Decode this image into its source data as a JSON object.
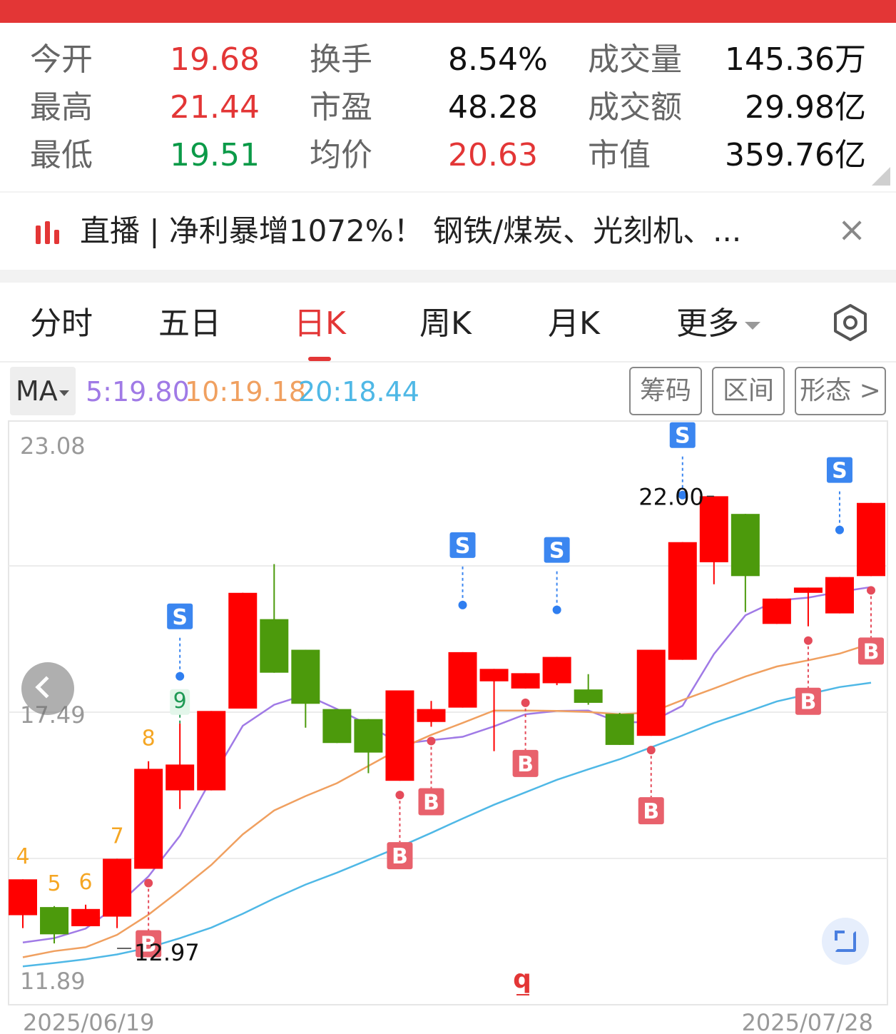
{
  "stats": [
    {
      "label": "今开",
      "value": "19.68",
      "color": "#e33636"
    },
    {
      "label": "换手",
      "value": "8.54%",
      "color": "#111111"
    },
    {
      "label": "成交量",
      "value": "145.36万",
      "color": "#111111"
    },
    {
      "label": "最高",
      "value": "21.44",
      "color": "#e33636"
    },
    {
      "label": "市盈",
      "value": "48.28",
      "color": "#111111"
    },
    {
      "label": "成交额",
      "value": "29.98亿",
      "color": "#111111"
    },
    {
      "label": "最低",
      "value": "19.51",
      "color": "#0b9a48"
    },
    {
      "label": "均价",
      "value": "20.63",
      "color": "#e33636"
    },
    {
      "label": "市值",
      "value": "359.76亿",
      "color": "#111111"
    }
  ],
  "news": {
    "text": "直播 | 净利暴增1072%！ 钢铁/煤炭、光刻机、...",
    "close": "×"
  },
  "tabs": [
    {
      "label": "分时"
    },
    {
      "label": "五日"
    },
    {
      "label": "日K"
    },
    {
      "label": "周K"
    },
    {
      "label": "月K"
    },
    {
      "label": "更多"
    }
  ],
  "active_tab": "日K",
  "indicator": {
    "selector": "MA",
    "ma5": "5:19.80",
    "ma10": "10:19.18",
    "ma20": "20:18.44",
    "ma5_color": "#a07ae6",
    "ma10_color": "#f0a060",
    "ma20_color": "#4fb8e6"
  },
  "pills": [
    "筹码",
    "区间",
    "形态 >"
  ],
  "chart_data": {
    "type": "candlestick",
    "y_axis_labels": [
      "23.08",
      "17.49",
      "11.89"
    ],
    "ylim": [
      11.89,
      23.08
    ],
    "x_axis_labels": [
      "2025/06/19",
      "2025/07/28"
    ],
    "max_label": "22.00",
    "min_label": "12.97",
    "up_color": "#ff0000",
    "down_color": "#4c9a0c",
    "candles": [
      {
        "o": 13.24,
        "h": 13.65,
        "l": 12.97,
        "c": 13.99
      },
      {
        "o": 13.41,
        "h": 13.43,
        "l": 12.65,
        "c": 12.84
      },
      {
        "o": 13.01,
        "h": 13.46,
        "l": 13.07,
        "c": 13.37
      },
      {
        "o": 13.21,
        "h": 14.21,
        "l": 12.97,
        "c": 14.42
      },
      {
        "o": 14.21,
        "h": 16.46,
        "l": 15.85,
        "c": 16.3
      },
      {
        "o": 15.85,
        "h": 17.25,
        "l": 15.46,
        "c": 16.39
      },
      {
        "o": 15.85,
        "h": 17.51,
        "l": 17.51,
        "c": 17.51
      },
      {
        "o": 17.56,
        "h": 19.04,
        "l": 19.73,
        "c": 19.98
      },
      {
        "o": 19.43,
        "h": 20.58,
        "l": 18.31,
        "c": 18.31
      },
      {
        "o": 18.79,
        "h": 17.82,
        "l": 17.16,
        "c": 17.66
      },
      {
        "o": 17.55,
        "h": 17.53,
        "l": 16.84,
        "c": 16.84
      },
      {
        "o": 17.34,
        "h": 16.86,
        "l": 16.21,
        "c": 16.64
      },
      {
        "o": 16.05,
        "h": 17.64,
        "l": 17.77,
        "c": 17.94
      },
      {
        "o": 17.28,
        "h": 17.72,
        "l": 17.18,
        "c": 17.55
      },
      {
        "o": 17.58,
        "h": 17.95,
        "l": 17.63,
        "c": 18.74
      },
      {
        "o": 18.13,
        "h": 18.21,
        "l": 16.67,
        "c": 18.39
      },
      {
        "o": 17.98,
        "h": 18.24,
        "l": 18.05,
        "c": 18.3
      },
      {
        "o": 18.09,
        "h": 18.46,
        "l": 18.05,
        "c": 18.64
      },
      {
        "o": 17.96,
        "h": 18.28,
        "l": 17.64,
        "c": 17.68
      },
      {
        "o": 17.45,
        "h": 17.47,
        "l": 16.99,
        "c": 16.8
      },
      {
        "o": 16.99,
        "h": 18.36,
        "l": 18.36,
        "c": 18.79
      },
      {
        "o": 18.58,
        "h": 20.43,
        "l": 20.75,
        "c": 21.04
      },
      {
        "o": 20.62,
        "h": 20.62,
        "l": 20.16,
        "c": 22.0
      },
      {
        "o": 21.63,
        "h": 19.98,
        "l": 19.58,
        "c": 20.33
      },
      {
        "o": 19.33,
        "h": 19.85,
        "l": 19.82,
        "c": 19.86
      },
      {
        "o": 19.98,
        "h": 19.48,
        "l": 19.28,
        "c": 20.09
      },
      {
        "o": 19.55,
        "h": 19.76,
        "l": 19.96,
        "c": 20.31
      },
      {
        "o": 20.33,
        "h": 21.44,
        "l": 21.44,
        "c": 21.86
      }
    ],
    "series": [
      {
        "name": "MA5",
        "values": [
          12.67,
          12.76,
          12.96,
          13.44,
          14.05,
          14.9,
          16.08,
          17.2,
          17.64,
          17.85,
          17.55,
          17.22,
          16.82,
          16.9,
          16.97,
          17.19,
          17.44,
          17.51,
          17.52,
          17.27,
          17.28,
          17.62,
          18.7,
          19.51,
          19.82,
          19.88,
          20.0,
          20.1
        ]
      },
      {
        "name": "MA10",
        "values": [
          12.36,
          12.49,
          12.57,
          12.83,
          13.25,
          13.76,
          14.29,
          14.93,
          15.43,
          15.73,
          16.0,
          16.36,
          16.72,
          17.01,
          17.26,
          17.52,
          17.52,
          17.51,
          17.49,
          17.44,
          17.48,
          17.74,
          17.98,
          18.23,
          18.44,
          18.57,
          18.71,
          18.92
        ]
      },
      {
        "name": "MA20",
        "values": [
          12.17,
          12.24,
          12.32,
          12.42,
          12.56,
          12.76,
          12.98,
          13.27,
          13.59,
          13.88,
          14.13,
          14.4,
          14.67,
          14.96,
          15.26,
          15.55,
          15.81,
          16.07,
          16.29,
          16.5,
          16.75,
          17.0,
          17.26,
          17.48,
          17.71,
          17.86,
          18.01,
          18.1
        ]
      }
    ],
    "signals": [
      {
        "index": 0,
        "type": "num",
        "label": "4",
        "pos": "above"
      },
      {
        "index": 1,
        "type": "num",
        "label": "5",
        "pos": "above"
      },
      {
        "index": 2,
        "type": "num",
        "label": "6",
        "pos": "above"
      },
      {
        "index": 3,
        "type": "num",
        "label": "7",
        "pos": "above"
      },
      {
        "index": 4,
        "type": "num",
        "label": "8",
        "pos": "above"
      },
      {
        "index": 4,
        "type": "B",
        "label": "B",
        "pos": "below"
      },
      {
        "index": 5,
        "type": "num9",
        "label": "9",
        "pos": "above"
      },
      {
        "index": 5,
        "type": "S",
        "label": "S",
        "pos": "above"
      },
      {
        "index": 12,
        "type": "B",
        "label": "B",
        "pos": "below"
      },
      {
        "index": 13,
        "type": "B",
        "label": "B",
        "pos": "below"
      },
      {
        "index": 14,
        "type": "S",
        "label": "S",
        "pos": "above"
      },
      {
        "index": 16,
        "type": "B",
        "label": "B",
        "pos": "below"
      },
      {
        "index": 17,
        "type": "S",
        "label": "S",
        "pos": "above"
      },
      {
        "index": 20,
        "type": "B",
        "label": "B",
        "pos": "below"
      },
      {
        "index": 21,
        "type": "S",
        "label": "S",
        "pos": "above"
      },
      {
        "index": 25,
        "type": "B",
        "label": "B",
        "pos": "below"
      },
      {
        "index": 26,
        "type": "S",
        "label": "S",
        "pos": "above"
      },
      {
        "index": 27,
        "type": "B",
        "label": "B",
        "pos": "below"
      }
    ],
    "extra_text": "q"
  }
}
